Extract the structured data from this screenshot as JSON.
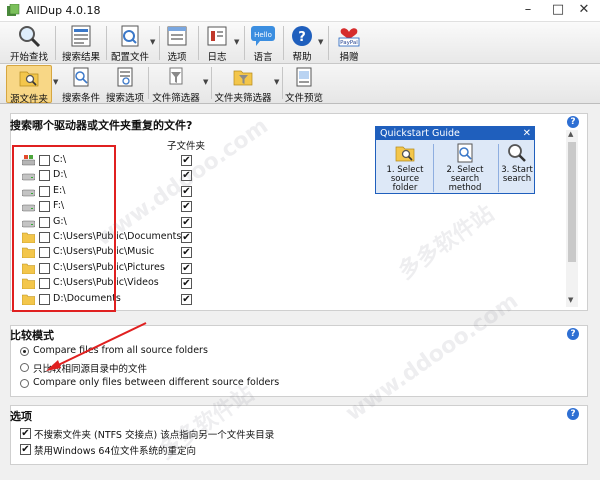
{
  "window": {
    "title": "AllDup 4.0.18",
    "min": "–",
    "max": "□",
    "close": "✕"
  },
  "toolbar1": [
    {
      "label": "开始查找"
    },
    {
      "label": "搜索结果"
    },
    {
      "label": "配置文件"
    },
    {
      "label": "选项"
    },
    {
      "label": "日志"
    },
    {
      "label": "语言",
      "icon_text": "Hello"
    },
    {
      "label": "帮助"
    },
    {
      "label": "捐赠",
      "icon_text": "PayPal"
    }
  ],
  "toolbar2": [
    {
      "label": "源文件夹"
    },
    {
      "label": "搜索条件"
    },
    {
      "label": "搜索选项"
    },
    {
      "label": "文件筛选器"
    },
    {
      "label": "文件夹筛选器"
    },
    {
      "label": "文件预览"
    }
  ],
  "source_panel": {
    "title": "搜索哪个驱动器或文件夹重复的文件?",
    "subfolder_header": "子文件夹",
    "check_mark": "✔",
    "items": [
      {
        "name": "C:\\",
        "type": "drive-system",
        "subfolders": true
      },
      {
        "name": "D:\\",
        "type": "drive",
        "subfolders": true
      },
      {
        "name": "E:\\",
        "type": "drive",
        "subfolders": true
      },
      {
        "name": "F:\\",
        "type": "drive",
        "subfolders": true
      },
      {
        "name": "G:\\",
        "type": "drive",
        "subfolders": true
      },
      {
        "name": "C:\\Users\\Public\\Documents",
        "type": "folder",
        "subfolders": true
      },
      {
        "name": "C:\\Users\\Public\\Music",
        "type": "folder",
        "subfolders": true
      },
      {
        "name": "C:\\Users\\Public\\Pictures",
        "type": "folder",
        "subfolders": true
      },
      {
        "name": "C:\\Users\\Public\\Videos",
        "type": "folder",
        "subfolders": true
      },
      {
        "name": "D:\\Documents",
        "type": "folder",
        "subfolders": true
      }
    ]
  },
  "quickstart": {
    "title": "Quickstart Guide",
    "close": "✕",
    "steps": [
      {
        "line1": "1. Select",
        "line2": "source folder"
      },
      {
        "line1": "2. Select",
        "line2": "search method"
      },
      {
        "line1": "3. Start",
        "line2": "search"
      }
    ]
  },
  "compare_panel": {
    "title": "比较模式",
    "options": [
      {
        "label": "Compare files from all source folders",
        "selected": true
      },
      {
        "label": "只比较相同源目录中的文件",
        "selected": false
      },
      {
        "label": "Compare only files between different source folders",
        "selected": false
      }
    ]
  },
  "options_panel": {
    "title": "选项",
    "items": [
      {
        "label": "不搜索文件夹 (NTFS 交接点) 该点指向另一个文件夹目录",
        "checked": true
      },
      {
        "label": "禁用Windows 64位文件系统的重定向",
        "checked": true
      }
    ]
  },
  "help_label": "?",
  "watermarks": [
    "www.ddooo.com",
    "多多软件站",
    "www.ddooo.com",
    "多多软件站"
  ]
}
